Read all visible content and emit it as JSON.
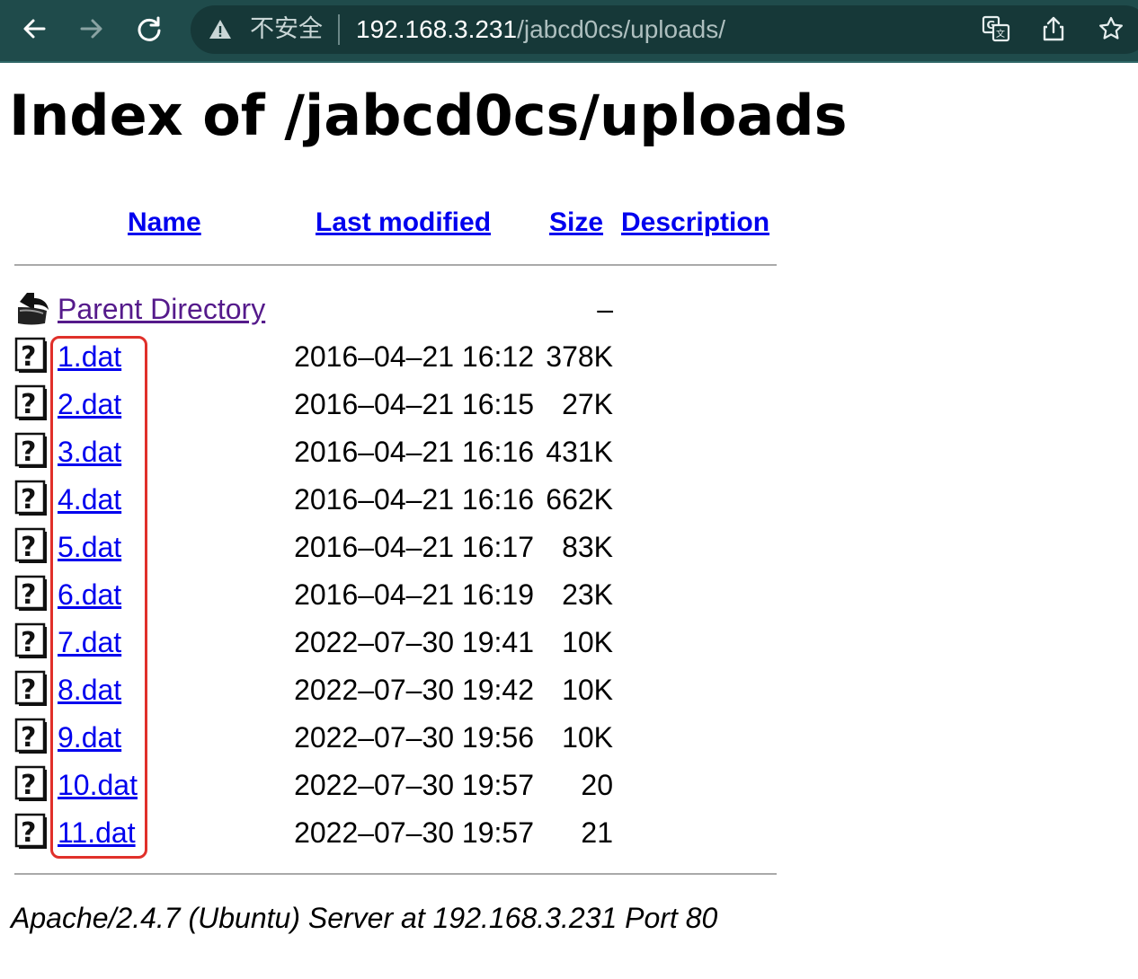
{
  "browser": {
    "security_label": "不安全",
    "url_host": "192.168.3.231",
    "url_path": "/jabcd0cs/uploads/",
    "icons": [
      "back-arrow-icon",
      "forward-arrow-icon",
      "reload-icon",
      "warning-icon",
      "translate-icon",
      "share-icon",
      "star-icon"
    ]
  },
  "page": {
    "title": "Index of /jabcd0cs/uploads",
    "columns": {
      "name": "Name",
      "last_modified": "Last modified",
      "size": "Size",
      "description": "Description"
    },
    "parent": {
      "label": "Parent Directory",
      "size": "–"
    },
    "files": [
      {
        "name": "1.dat",
        "modified": "2016–04–21 16:12",
        "size": "378K"
      },
      {
        "name": "2.dat",
        "modified": "2016–04–21 16:15",
        "size": "27K"
      },
      {
        "name": "3.dat",
        "modified": "2016–04–21 16:16",
        "size": "431K"
      },
      {
        "name": "4.dat",
        "modified": "2016–04–21 16:16",
        "size": "662K"
      },
      {
        "name": "5.dat",
        "modified": "2016–04–21 16:17",
        "size": "83K"
      },
      {
        "name": "6.dat",
        "modified": "2016–04–21 16:19",
        "size": "23K"
      },
      {
        "name": "7.dat",
        "modified": "2022–07–30 19:41",
        "size": "10K"
      },
      {
        "name": "8.dat",
        "modified": "2022–07–30 19:42",
        "size": "10K"
      },
      {
        "name": "9.dat",
        "modified": "2022–07–30 19:56",
        "size": "10K"
      },
      {
        "name": "10.dat",
        "modified": "2022–07–30 19:57",
        "size": "20"
      },
      {
        "name": "11.dat",
        "modified": "2022–07–30 19:57",
        "size": "21"
      }
    ],
    "footer": "Apache/2.4.7 (Ubuntu) Server at 192.168.3.231 Port 80"
  },
  "colors": {
    "toolbar_bg": "#1f4b4b",
    "link": "#0000ee",
    "visited_link": "#551a8b",
    "highlight_box": "#e0302a"
  }
}
